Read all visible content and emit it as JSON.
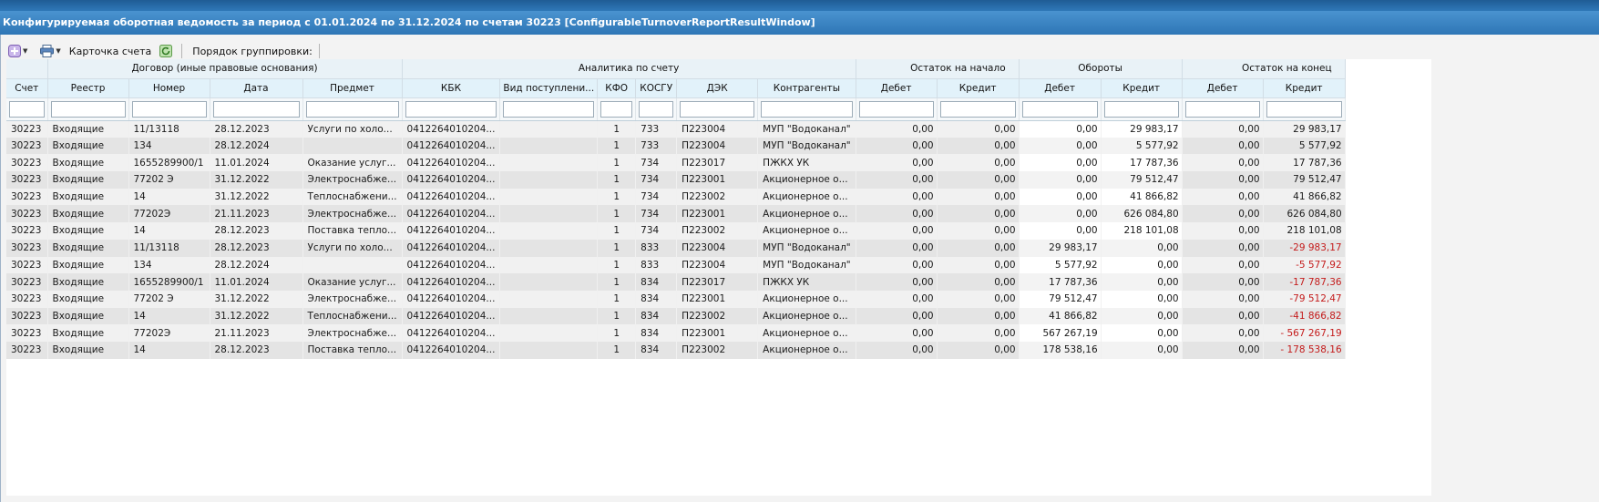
{
  "window": {
    "title": "Конфигурируемая оборотная ведомость за период с 01.01.2024 по 31.12.2024 по счетам 30223 [ConfigurableTurnoverReportResultWindow]"
  },
  "toolbar": {
    "card_label": "Карточка счета",
    "grouping_label": "Порядок группировки:"
  },
  "colors": {
    "title_bg": "#2e76b6",
    "header_bg": "#e2f2fa",
    "negative": "#c41b1b"
  },
  "grid": {
    "groups": [
      {
        "label": "",
        "span": 1
      },
      {
        "label": "Договор (иные правовые основания)",
        "span": 4
      },
      {
        "label": "Аналитика по счету",
        "span": 6
      },
      {
        "label": "Остаток на начало",
        "span": 2
      },
      {
        "label": "Обороты",
        "span": 2
      },
      {
        "label": "Остаток на конец",
        "span": 2
      }
    ],
    "columns": [
      "Счет",
      "Реестр",
      "Номер",
      "Дата",
      "Предмет",
      "КБК",
      "Вид поступлени...",
      "КФО",
      "КОСГУ",
      "ДЭК",
      "Контрагенты",
      "Дебет",
      "Кредит",
      "Дебет",
      "Кредит",
      "Дебет",
      "Кредит"
    ],
    "rows": [
      [
        "30223",
        "Входящие",
        "11/13118",
        "28.12.2023",
        "Услуги по холо...",
        "0412264010204...",
        "",
        "1",
        "733",
        "П223004",
        "МУП \"Водоканал\"",
        "0,00",
        "0,00",
        "0,00",
        "29 983,17",
        "0,00",
        "29 983,17"
      ],
      [
        "30223",
        "Входящие",
        "134",
        "28.12.2024",
        "",
        "0412264010204...",
        "",
        "1",
        "733",
        "П223004",
        "МУП \"Водоканал\"",
        "0,00",
        "0,00",
        "0,00",
        "5 577,92",
        "0,00",
        "5 577,92"
      ],
      [
        "30223",
        "Входящие",
        "1655289900/1",
        "11.01.2024",
        "Оказание услуг...",
        "0412264010204...",
        "",
        "1",
        "734",
        "П223017",
        "ПЖКХ УК",
        "0,00",
        "0,00",
        "0,00",
        "17 787,36",
        "0,00",
        "17 787,36"
      ],
      [
        "30223",
        "Входящие",
        "77202 Э",
        "31.12.2022",
        "Электроснабже...",
        "0412264010204...",
        "",
        "1",
        "734",
        "П223001",
        "Акционерное о...",
        "0,00",
        "0,00",
        "0,00",
        "79 512,47",
        "0,00",
        "79 512,47"
      ],
      [
        "30223",
        "Входящие",
        "14",
        "31.12.2022",
        "Теплоснабжени...",
        "0412264010204...",
        "",
        "1",
        "734",
        "П223002",
        "Акционерное о...",
        "0,00",
        "0,00",
        "0,00",
        "41 866,82",
        "0,00",
        "41 866,82"
      ],
      [
        "30223",
        "Входящие",
        "77202Э",
        "21.11.2023",
        "Электроснабже...",
        "0412264010204...",
        "",
        "1",
        "734",
        "П223001",
        "Акционерное о...",
        "0,00",
        "0,00",
        "0,00",
        "626 084,80",
        "0,00",
        "626 084,80"
      ],
      [
        "30223",
        "Входящие",
        "14",
        "28.12.2023",
        "Поставка тепло...",
        "0412264010204...",
        "",
        "1",
        "734",
        "П223002",
        "Акционерное о...",
        "0,00",
        "0,00",
        "0,00",
        "218 101,08",
        "0,00",
        "218 101,08"
      ],
      [
        "30223",
        "Входящие",
        "11/13118",
        "28.12.2023",
        "Услуги по холо...",
        "0412264010204...",
        "",
        "1",
        "833",
        "П223004",
        "МУП \"Водоканал\"",
        "0,00",
        "0,00",
        "29 983,17",
        "0,00",
        "0,00",
        "-29 983,17"
      ],
      [
        "30223",
        "Входящие",
        "134",
        "28.12.2024",
        "",
        "0412264010204...",
        "",
        "1",
        "833",
        "П223004",
        "МУП \"Водоканал\"",
        "0,00",
        "0,00",
        "5 577,92",
        "0,00",
        "0,00",
        "-5 577,92"
      ],
      [
        "30223",
        "Входящие",
        "1655289900/1",
        "11.01.2024",
        "Оказание услуг...",
        "0412264010204...",
        "",
        "1",
        "834",
        "П223017",
        "ПЖКХ УК",
        "0,00",
        "0,00",
        "17 787,36",
        "0,00",
        "0,00",
        "-17 787,36"
      ],
      [
        "30223",
        "Входящие",
        "77202 Э",
        "31.12.2022",
        "Электроснабже...",
        "0412264010204...",
        "",
        "1",
        "834",
        "П223001",
        "Акционерное о...",
        "0,00",
        "0,00",
        "79 512,47",
        "0,00",
        "0,00",
        "-79 512,47"
      ],
      [
        "30223",
        "Входящие",
        "14",
        "31.12.2022",
        "Теплоснабжени...",
        "0412264010204...",
        "",
        "1",
        "834",
        "П223002",
        "Акционерное о...",
        "0,00",
        "0,00",
        "41 866,82",
        "0,00",
        "0,00",
        "-41 866,82"
      ],
      [
        "30223",
        "Входящие",
        "77202Э",
        "21.11.2023",
        "Электроснабже...",
        "0412264010204...",
        "",
        "1",
        "834",
        "П223001",
        "Акционерное о...",
        "0,00",
        "0,00",
        "567 267,19",
        "0,00",
        "0,00",
        "- 567 267,19"
      ],
      [
        "30223",
        "Входящие",
        "14",
        "28.12.2023",
        "Поставка тепло...",
        "0412264010204...",
        "",
        "1",
        "834",
        "П223002",
        "Акционерное о...",
        "0,00",
        "0,00",
        "178 538,16",
        "0,00",
        "0,00",
        "- 178 538,16"
      ]
    ]
  }
}
